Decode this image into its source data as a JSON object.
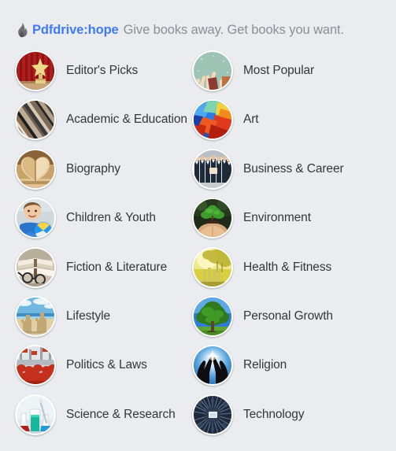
{
  "header": {
    "flame_icon": "flame-icon",
    "brand": "Pdfdrive:hope",
    "tagline": "Give books away. Get books you want."
  },
  "colors": {
    "background": "#eaecef",
    "brand_link": "#3d7bfb",
    "tagline": "#8a8f96",
    "label_text": "#33363b",
    "avatar_ring": "#ffffff"
  },
  "categories": {
    "rows": [
      [
        {
          "label": "Editor's Picks",
          "icon": "trophy-curtain-icon"
        },
        {
          "label": "Most Popular",
          "icon": "thumbs-up-icon"
        }
      ],
      [
        {
          "label": "Academic & Education",
          "icon": "book-spines-icon"
        },
        {
          "label": "Art",
          "icon": "paint-splash-icon"
        }
      ],
      [
        {
          "label": "Biography",
          "icon": "open-book-heart-icon"
        },
        {
          "label": "Business & Career",
          "icon": "business-people-icon"
        }
      ],
      [
        {
          "label": "Children & Youth",
          "icon": "child-with-ball-icon"
        },
        {
          "label": "Environment",
          "icon": "hands-holding-plant-icon"
        }
      ],
      [
        {
          "label": "Fiction & Literature",
          "icon": "books-and-glasses-icon"
        },
        {
          "label": "Health & Fitness",
          "icon": "golden-landscape-icon"
        }
      ],
      [
        {
          "label": "Lifestyle",
          "icon": "beach-sandcastle-icon"
        },
        {
          "label": "Personal Growth",
          "icon": "green-tree-icon"
        }
      ],
      [
        {
          "label": "Politics & Laws",
          "icon": "crowd-protest-icon"
        },
        {
          "label": "Religion",
          "icon": "praying-hands-light-icon"
        }
      ],
      [
        {
          "label": "Science & Research",
          "icon": "lab-beakers-icon"
        },
        {
          "label": "Technology",
          "icon": "circuit-chip-icon"
        }
      ]
    ]
  }
}
